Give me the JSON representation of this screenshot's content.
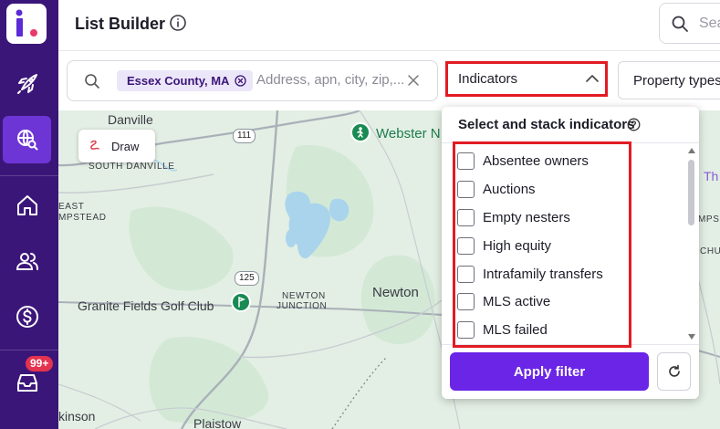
{
  "header": {
    "title": "List Builder",
    "search_placeholder": "Sea"
  },
  "filters": {
    "location_chip": "Essex County, MA",
    "location_placeholder": "Address, apn, city, zip,...",
    "indicators_label": "Indicators",
    "property_types_label": "Property types"
  },
  "sidebar": {
    "inbox_badge": "99+",
    "items": [
      {
        "name": "rocket-icon"
      },
      {
        "name": "globe-search-icon",
        "active": true
      },
      {
        "name": "home-icon"
      },
      {
        "name": "users-icon"
      },
      {
        "name": "dollar-icon"
      },
      {
        "name": "inbox-icon"
      }
    ]
  },
  "indicators_popup": {
    "title": "Select and stack indicators",
    "options": [
      {
        "label": "Absentee owners",
        "checked": false
      },
      {
        "label": "Auctions",
        "checked": false
      },
      {
        "label": "Empty nesters",
        "checked": false
      },
      {
        "label": "High equity",
        "checked": false
      },
      {
        "label": "Intrafamily transfers",
        "checked": false
      },
      {
        "label": "MLS active",
        "checked": false
      },
      {
        "label": "MLS failed",
        "checked": false
      }
    ],
    "apply_label": "Apply filter"
  },
  "map": {
    "draw_label": "Draw",
    "labels": {
      "danville": "Danville",
      "south_danville": "SOUTH DANVILLE",
      "east": "EAST",
      "mpstead": "MPSTEAD",
      "webster": "Webster N",
      "granite": "Granite Fields Golf Club",
      "newton_junction_1": "NEWTON",
      "newton_junction_2": "JUNCTION",
      "newton": "Newton",
      "kinson": "kinson",
      "plaistow": "Plaistow",
      "mps": "MPS",
      "chu": "CHU",
      "th": "Th"
    },
    "routes": [
      "111",
      "125"
    ]
  },
  "colors": {
    "sidebar": "#3b1679",
    "accent": "#6a25e6",
    "highlight": "#e21b23",
    "map": "#e3efe4"
  }
}
